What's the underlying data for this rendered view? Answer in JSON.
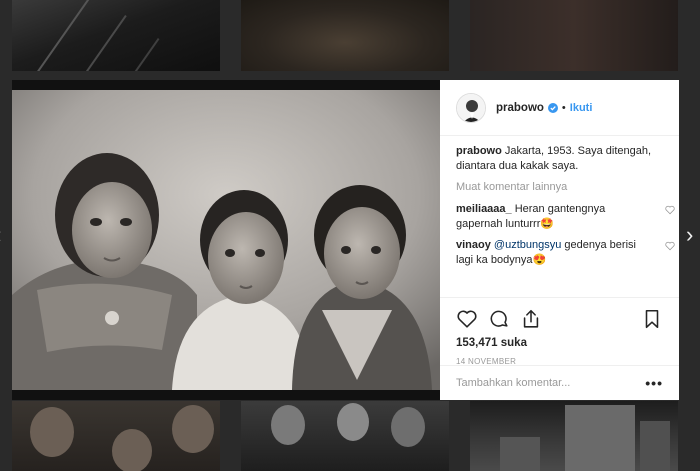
{
  "post": {
    "username": "prabowo",
    "separator": "•",
    "follow_label": "Ikuti",
    "caption_user": "prabowo",
    "caption_text": " Jakarta, 1953. Saya ditengah, diantara dua kakak saya.",
    "load_more": "Muat komentar lainnya",
    "comments": [
      {
        "user": "meiliaaaa_",
        "text": " Heran gantengnya gapernah lunturrr🤩"
      },
      {
        "user": "vinaoy",
        "mention": " @uztbungsyu",
        "text": " gedenya berisi lagi ka bodynya😍"
      }
    ],
    "likes": "153,471 suka",
    "date": "14 November",
    "comment_placeholder": "Tambahkan komentar...",
    "more_options": "•••"
  },
  "nav": {
    "prev": "‹",
    "next": "›"
  },
  "colors": {
    "link_blue": "#3897f0",
    "verified_blue": "#3897f0",
    "text": "#262626",
    "muted": "#999999"
  },
  "icons": {
    "like": "heart-icon",
    "comment": "comment-icon",
    "share": "share-icon",
    "save": "bookmark-icon",
    "verified": "verified-badge-icon"
  }
}
